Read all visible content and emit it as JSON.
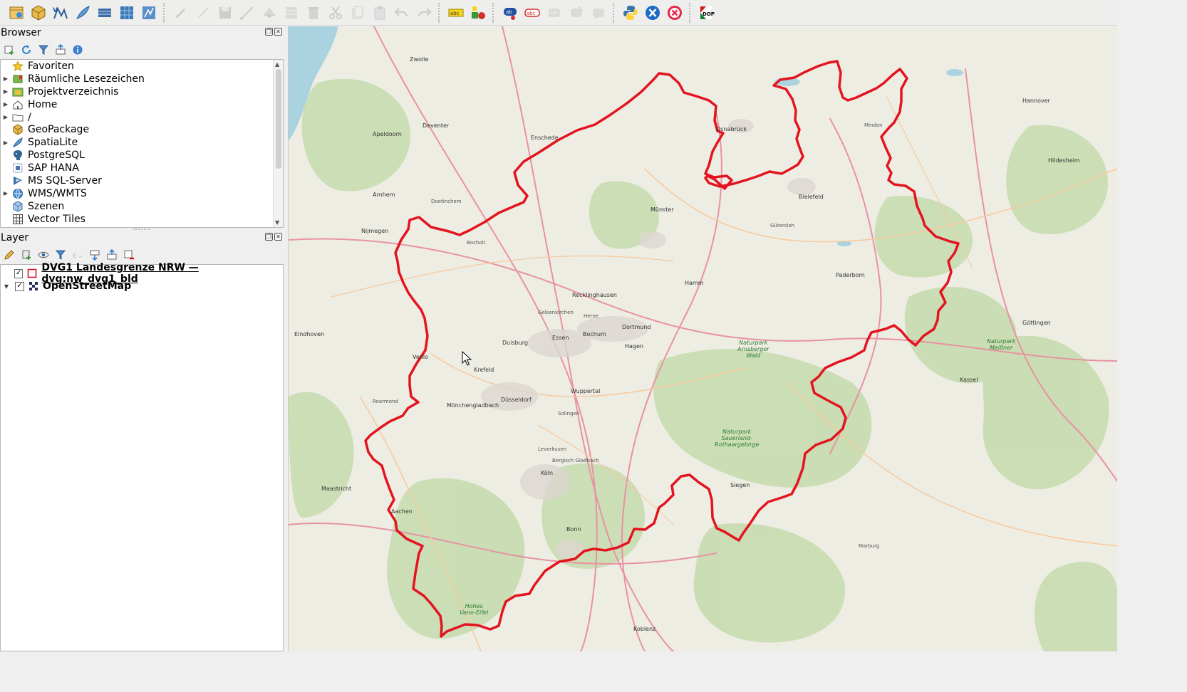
{
  "toolbar": {
    "icons": [
      {
        "name": "open-data-source-manager-icon",
        "state": "enabled"
      },
      {
        "name": "new-geopackage-layer-icon",
        "state": "enabled"
      },
      {
        "name": "new-shapefile-layer-icon",
        "state": "enabled"
      },
      {
        "name": "new-spatialite-layer-icon",
        "state": "enabled"
      },
      {
        "name": "add-wms-layer-icon",
        "state": "enabled"
      },
      {
        "name": "add-raster-layer-icon",
        "state": "enabled"
      },
      {
        "name": "add-wfs-layer-icon",
        "state": "enabled"
      },
      {
        "name": "edit-pencil-icon",
        "state": "disabled"
      },
      {
        "name": "toggle-editing-icon",
        "state": "disabled"
      },
      {
        "name": "save-edits-icon",
        "state": "disabled"
      },
      {
        "name": "digitize-icon",
        "state": "disabled"
      },
      {
        "name": "vertex-tool-icon",
        "state": "disabled"
      },
      {
        "name": "modify-attributes-icon",
        "state": "disabled"
      },
      {
        "name": "delete-selected-icon",
        "state": "disabled"
      },
      {
        "name": "cut-features-icon",
        "state": "disabled"
      },
      {
        "name": "copy-features-icon",
        "state": "disabled"
      },
      {
        "name": "paste-features-icon",
        "state": "disabled"
      },
      {
        "name": "undo-icon",
        "state": "disabled"
      },
      {
        "name": "redo-icon",
        "state": "disabled"
      },
      {
        "name": "label-toolbar-icon",
        "state": "enabled"
      },
      {
        "name": "layer-diagram-icon",
        "state": "enabled"
      },
      {
        "name": "label-pin-icon",
        "state": "enabled"
      },
      {
        "name": "label-highlight-icon",
        "state": "enabled"
      },
      {
        "name": "label-move-icon",
        "state": "disabled"
      },
      {
        "name": "label-rotate-icon",
        "state": "disabled"
      },
      {
        "name": "label-change-icon",
        "state": "disabled"
      },
      {
        "name": "python-console-icon",
        "state": "enabled"
      },
      {
        "name": "plugin-x-icon",
        "state": "enabled"
      },
      {
        "name": "plugin-close-icon",
        "state": "enabled"
      },
      {
        "name": "dop-plugin-icon",
        "state": "enabled"
      }
    ],
    "badges": {
      "abc": "abc",
      "ab": "ab",
      "dop": "DOP"
    }
  },
  "browser": {
    "title": "Browser",
    "items": [
      {
        "label": "Favoriten",
        "icon": "star-icon",
        "expandable": false
      },
      {
        "label": "Räumliche Lesezeichen",
        "icon": "bookmark-icon",
        "expandable": true
      },
      {
        "label": "Projektverzeichnis",
        "icon": "project-folder-icon",
        "expandable": true
      },
      {
        "label": "Home",
        "icon": "home-icon",
        "expandable": true
      },
      {
        "label": "/",
        "icon": "folder-icon",
        "expandable": true
      },
      {
        "label": "GeoPackage",
        "icon": "geopackage-icon",
        "expandable": false
      },
      {
        "label": "SpatiaLite",
        "icon": "spatialite-icon",
        "expandable": true
      },
      {
        "label": "PostgreSQL",
        "icon": "postgresql-icon",
        "expandable": false
      },
      {
        "label": "SAP HANA",
        "icon": "sap-hana-icon",
        "expandable": false
      },
      {
        "label": "MS SQL-Server",
        "icon": "mssql-icon",
        "expandable": false
      },
      {
        "label": "WMS/WMTS",
        "icon": "globe-icon",
        "expandable": true
      },
      {
        "label": "Szenen",
        "icon": "scene-icon",
        "expandable": false
      },
      {
        "label": "Vector Tiles",
        "icon": "vector-tiles-icon",
        "expandable": false
      }
    ]
  },
  "layers": {
    "title": "Layer",
    "items": [
      {
        "label": "DVG1 Landesgrenze NRW — dvg:nw_dvg1_bld",
        "checked": true,
        "icon": "polygon-outline-symbol-icon",
        "expanded": false
      },
      {
        "label": "OpenStreetMap",
        "checked": true,
        "icon": "raster-tile-icon",
        "expanded": true
      }
    ]
  },
  "map": {
    "boundary_color": "#e3141f",
    "labels": [
      {
        "text": "Zwolle",
        "kind": "city"
      },
      {
        "text": "Deventer",
        "kind": "city"
      },
      {
        "text": "Apeldoorn",
        "kind": "city"
      },
      {
        "text": "Enschede",
        "kind": "city"
      },
      {
        "text": "Arnhem",
        "kind": "city"
      },
      {
        "text": "Nijmegen",
        "kind": "city"
      },
      {
        "text": "Doetinchem",
        "kind": "town"
      },
      {
        "text": "Bocholt",
        "kind": "town"
      },
      {
        "text": "Osnabrück",
        "kind": "city"
      },
      {
        "text": "Münster",
        "kind": "city"
      },
      {
        "text": "Bielefeld",
        "kind": "city"
      },
      {
        "text": "Gütersloh",
        "kind": "town"
      },
      {
        "text": "Paderborn",
        "kind": "city"
      },
      {
        "text": "Hannover",
        "kind": "city"
      },
      {
        "text": "Hildesheim",
        "kind": "city"
      },
      {
        "text": "Minden",
        "kind": "town"
      },
      {
        "text": "Recklinghausen",
        "kind": "city"
      },
      {
        "text": "Gelsenkirchen",
        "kind": "town"
      },
      {
        "text": "Herne",
        "kind": "town"
      },
      {
        "text": "Dortmund",
        "kind": "city"
      },
      {
        "text": "Bochum",
        "kind": "city"
      },
      {
        "text": "Hamm",
        "kind": "city"
      },
      {
        "text": "Duisburg",
        "kind": "city"
      },
      {
        "text": "Essen",
        "kind": "city"
      },
      {
        "text": "Krefeld",
        "kind": "city"
      },
      {
        "text": "Düsseldorf",
        "kind": "city"
      },
      {
        "text": "Mönchengladbach",
        "kind": "city"
      },
      {
        "text": "Wuppertal",
        "kind": "city"
      },
      {
        "text": "Solingen",
        "kind": "town"
      },
      {
        "text": "Hagen",
        "kind": "city"
      },
      {
        "text": "Köln",
        "kind": "city"
      },
      {
        "text": "Leverkusen",
        "kind": "town"
      },
      {
        "text": "Bergisch Gladbach",
        "kind": "town"
      },
      {
        "text": "Bonn",
        "kind": "city"
      },
      {
        "text": "Aachen",
        "kind": "city"
      },
      {
        "text": "Venlo",
        "kind": "city"
      },
      {
        "text": "Eindhoven",
        "kind": "city"
      },
      {
        "text": "Maastricht",
        "kind": "city"
      },
      {
        "text": "Roermond",
        "kind": "town"
      },
      {
        "text": "Siegen",
        "kind": "city"
      },
      {
        "text": "Kassel",
        "kind": "city"
      },
      {
        "text": "Göttingen",
        "kind": "city"
      },
      {
        "text": "Koblenz",
        "kind": "city"
      },
      {
        "text": "Marburg",
        "kind": "town"
      },
      {
        "text": "Naturpark\nSauerland-\nRothaargebirge",
        "kind": "park"
      },
      {
        "text": "Hohes\nVenn-Eifel",
        "kind": "park"
      },
      {
        "text": "Naturpark\nArnsberger\nWald",
        "kind": "park"
      },
      {
        "text": "Naturpark\nMeißner",
        "kind": "park"
      }
    ]
  }
}
